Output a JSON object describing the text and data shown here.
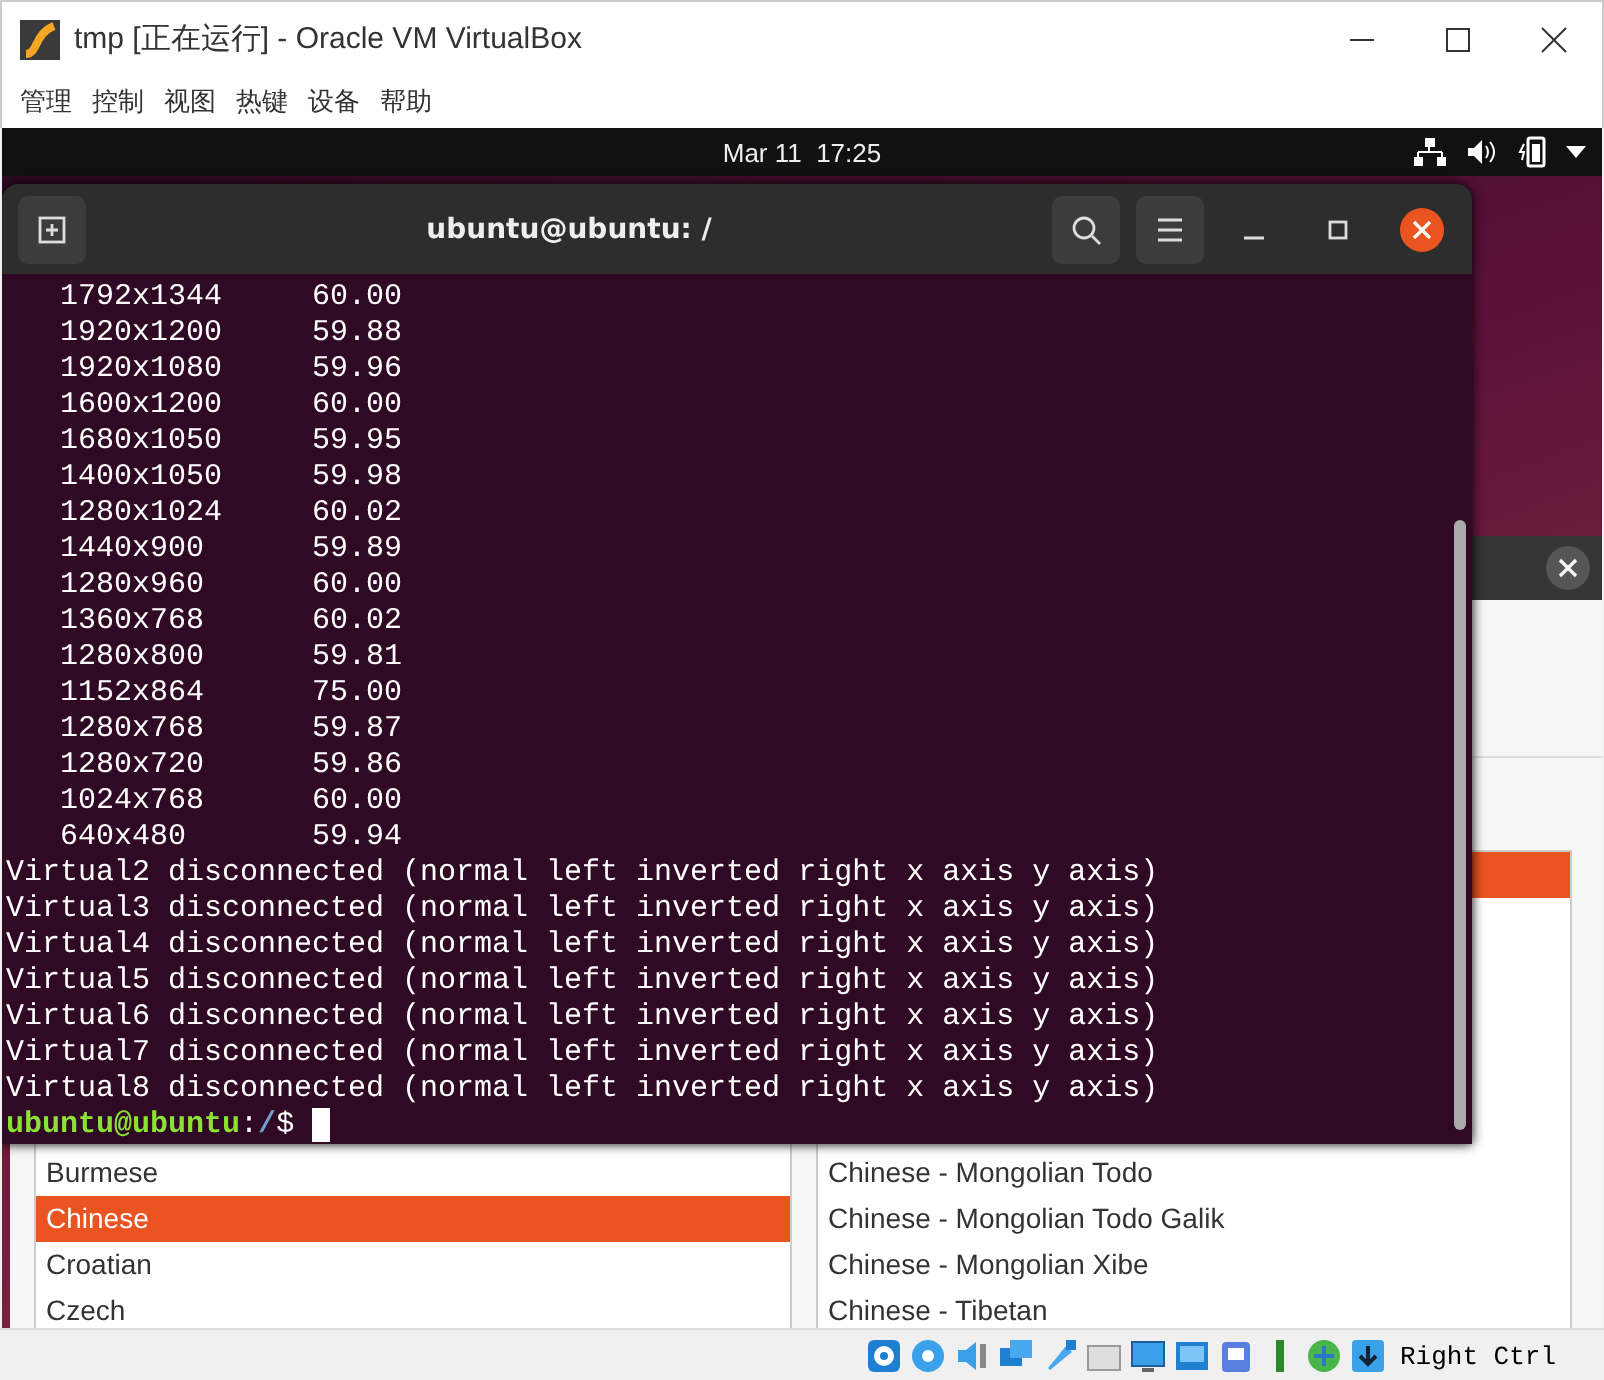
{
  "window": {
    "title": "tmp [正在运行] - Oracle VM VirtualBox",
    "menu": [
      "管理",
      "控制",
      "视图",
      "热键",
      "设备",
      "帮助"
    ]
  },
  "guest": {
    "top_bar": {
      "clock": "Mar 11  17:25"
    },
    "terminal": {
      "title": "ubuntu@ubuntu: /",
      "lines": [
        "   1792x1344     60.00",
        "   1920x1200     59.88",
        "   1920x1080     59.96",
        "   1600x1200     60.00",
        "   1680x1050     59.95",
        "   1400x1050     59.98",
        "   1280x1024     60.02",
        "   1440x900      59.89",
        "   1280x960      60.00",
        "   1360x768      60.02",
        "   1280x800      59.81",
        "   1152x864      75.00",
        "   1280x768      59.87",
        "   1280x720      59.86",
        "   1024x768      60.00",
        "   640x480       59.94",
        "Virtual2 disconnected (normal left inverted right x axis y axis)",
        "Virtual3 disconnected (normal left inverted right x axis y axis)",
        "Virtual4 disconnected (normal left inverted right x axis y axis)",
        "Virtual5 disconnected (normal left inverted right x axis y axis)",
        "Virtual6 disconnected (normal left inverted right x axis y axis)",
        "Virtual7 disconnected (normal left inverted right x axis y axis)",
        "Virtual8 disconnected (normal left inverted right x axis y axis)"
      ],
      "prompt": {
        "user_host": "ubuntu@ubuntu",
        "separator": ":",
        "path": "/",
        "symbol": "$"
      }
    },
    "language_dialog": {
      "left_list": [
        {
          "label": "Burmese",
          "selected": false
        },
        {
          "label": "Chinese",
          "selected": true
        },
        {
          "label": "Croatian",
          "selected": false
        },
        {
          "label": "Czech",
          "selected": false
        }
      ],
      "right_list": [
        {
          "selected": true
        },
        {
          "label": "Chinese - Mongolian Todo",
          "selected": false
        },
        {
          "label": "Chinese - Mongolian Todo Galik",
          "selected": false
        },
        {
          "label": "Chinese - Mongolian Xibe",
          "selected": false
        },
        {
          "label": "Chinese - Tibetan",
          "selected": false
        }
      ]
    }
  },
  "status_bar": {
    "host_key": "Right Ctrl"
  }
}
